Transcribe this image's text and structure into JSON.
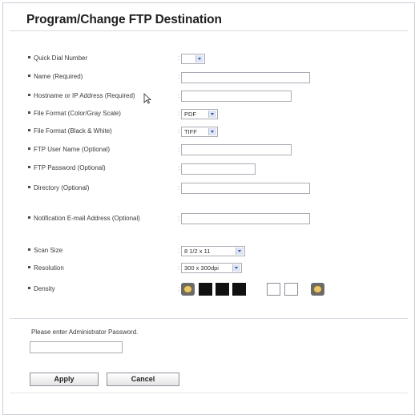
{
  "title": "Program/Change FTP Destination",
  "fields": [
    {
      "label": "Quick Dial Number"
    },
    {
      "label": "Name (Required)"
    },
    {
      "label": "Hostname or IP Address (Required)"
    },
    {
      "label": "File Format (Color/Gray Scale)"
    },
    {
      "label": "File Format (Black & White)"
    },
    {
      "label": "FTP User Name (Optional)"
    },
    {
      "label": "FTP Password (Optional)"
    },
    {
      "label": "Directory (Optional)"
    },
    {
      "label": "Notification E-mail Address (Optional)"
    },
    {
      "label": "Scan Size"
    },
    {
      "label": "Resolution"
    },
    {
      "label": "Density"
    }
  ],
  "separator": ":",
  "selects": {
    "quick_dial": "",
    "file_format_color": "PDF",
    "file_format_bw": "TIFF",
    "scan_size": "8 1/2 x 11",
    "resolution": "300 x 300dpi"
  },
  "density": {
    "levels": [
      "black",
      "black",
      "black",
      "white",
      "white"
    ],
    "selected_level": 3
  },
  "admin": {
    "prompt": "Please enter Administrator Password."
  },
  "buttons": {
    "apply": "Apply",
    "cancel": "Cancel"
  },
  "colors": {
    "accent_arrow": "#2a4fb0",
    "border": "#a8adb5"
  }
}
